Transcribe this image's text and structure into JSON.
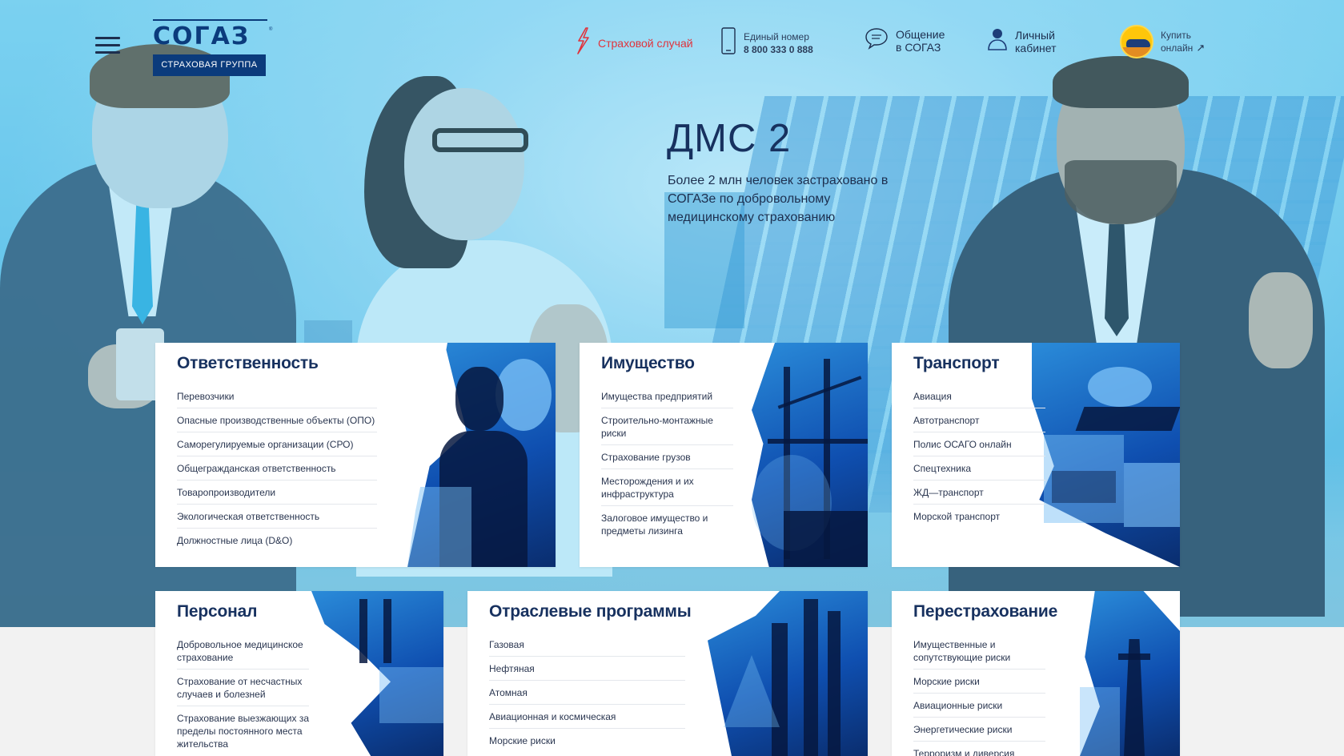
{
  "header": {
    "logo_word": "СОГАЗ",
    "logo_sub": "СТРАХОВАЯ ГРУППА",
    "insurance_case": "Страховой случай",
    "phone_label": "Единый номер",
    "phone_number": "8 800 333 0 888",
    "chat_line1": "Общение",
    "chat_line2": "в СОГАЗ",
    "cabinet_line1": "Личный",
    "cabinet_line2": "кабинет",
    "buy_line1": "Купить",
    "buy_line2": "онлайн",
    "buy_arrow": "↗"
  },
  "hero": {
    "title": "ДМС 2",
    "subtitle": "Более 2 млн человек застраховано в СОГАЗе по добровольному медицинскому страхованию"
  },
  "cards": [
    {
      "title": "Ответственность",
      "items": [
        "Перевозчики",
        "Опасные производственные объекты (ОПО)",
        "Саморегулируемые организации (СРО)",
        "Общегражданская ответственность",
        "Товаропроизводители",
        "Экологическая ответственность",
        "Должностные лица (D&O)"
      ]
    },
    {
      "title": "Имущество",
      "items": [
        "Имущества предприятий",
        "Строительно-монтажные риски",
        "Страхование грузов",
        "Месторождения и их инфраструктура",
        "Залоговое имущество и предметы лизинга"
      ]
    },
    {
      "title": "Транспорт",
      "items": [
        "Авиация",
        "Автотранспорт",
        "Полис ОСАГО онлайн",
        "Спецтехника",
        "ЖД—транспорт",
        "Морской транспорт"
      ]
    },
    {
      "title": "Персонал",
      "items": [
        "Добровольное медицинское страхование",
        "Страхование от несчастных случаев и болезней",
        "Страхование выезжающих за пределы постоянного места жительства"
      ]
    },
    {
      "title": "Отраслевые программы",
      "items": [
        "Газовая",
        "Нефтяная",
        "Атомная",
        "Авиационная и космическая",
        "Морские риски"
      ]
    },
    {
      "title": "Перестрахование",
      "items": [
        "Имущественные и сопутствующие риски",
        "Морские риски",
        "Авиационные риски",
        "Энергетические риски",
        "Терроризм и диверсия"
      ]
    }
  ],
  "colors": {
    "brand_dark": "#0b3b7c",
    "accent_red": "#e0333c",
    "card_art_blue": "#0f4fb0"
  },
  "icons": {
    "menu": "hamburger-icon",
    "insurance_case": "lightning-icon",
    "phone": "phone-icon",
    "chat": "chat-bubble-icon",
    "cabinet": "user-icon",
    "buy": "car-badge-icon"
  }
}
